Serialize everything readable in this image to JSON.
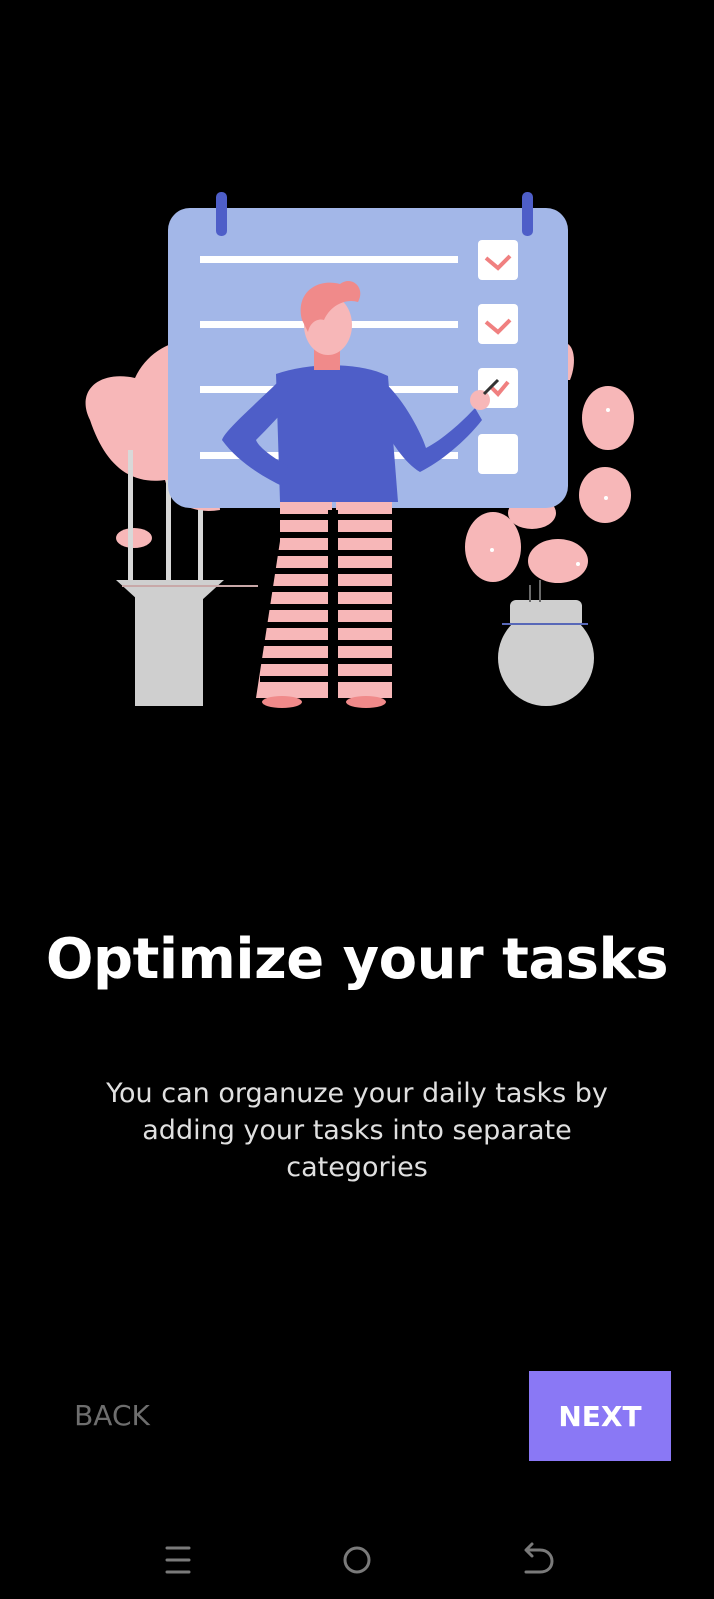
{
  "onboarding": {
    "title": "Optimize your tasks",
    "description": "You can organuze your daily tasks by adding your tasks into separate categories",
    "back_label": "BACK",
    "next_label": "NEXT",
    "accent_color": "#8a78f5"
  },
  "illustration": {
    "icon": "task-checklist-illustration"
  },
  "navbar": {
    "items": [
      "menu-icon",
      "home-icon",
      "back-icon"
    ]
  }
}
